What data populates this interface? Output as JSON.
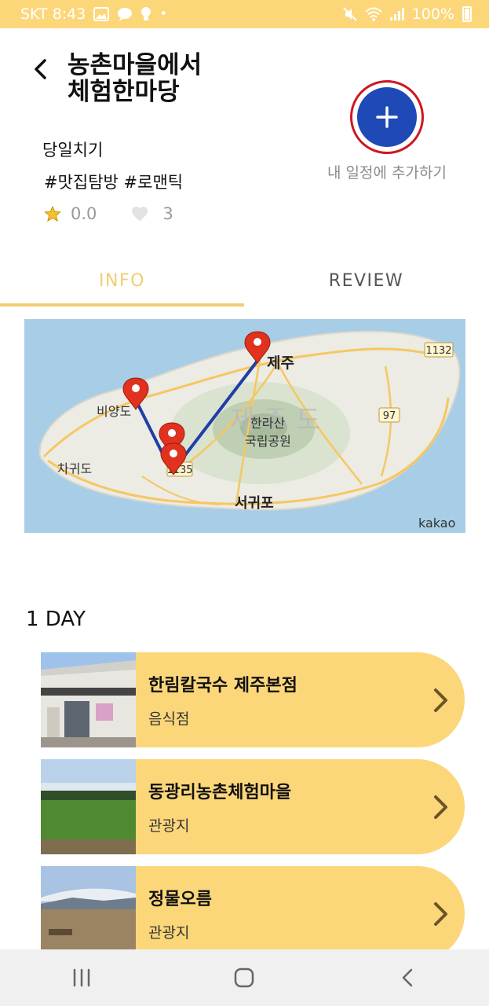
{
  "status_bar": {
    "carrier_time": "SKT 8:43",
    "battery": "100%"
  },
  "header": {
    "title": "농촌마을에서\n체험한마당",
    "add_label": "내 일정에 추가하기"
  },
  "info": {
    "trip_type": "당일치기",
    "tags": "#맛집탐방 #로맨틱",
    "rating": "0.0",
    "likes": "3"
  },
  "tabs": [
    {
      "label": "INFO"
    },
    {
      "label": "REVIEW"
    }
  ],
  "map": {
    "labels": {
      "jeju": "제주",
      "biyangdo": "비양도",
      "chagwido": "차귀도",
      "seogwipo": "서귀포",
      "jejudo": "제 주 도",
      "hallasan1": "한라산",
      "hallasan2": "국립공원",
      "road_1132": "1132",
      "road_97": "97",
      "road_1135": "1135",
      "provider": "kakao"
    }
  },
  "day": {
    "title": "1 DAY"
  },
  "places": [
    {
      "name": "한림칼국수 제주본점",
      "category": "음식점"
    },
    {
      "name": "동광리농촌체험마을",
      "category": "관광지"
    },
    {
      "name": "정물오름",
      "category": "관광지"
    }
  ],
  "colors": {
    "accent": "#fcd77a",
    "tab_active": "#f2cd73",
    "add_button": "#1e49b6",
    "highlight_ring": "#d01622"
  }
}
